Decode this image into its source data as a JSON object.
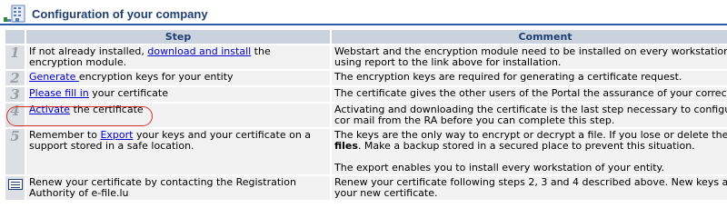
{
  "header": {
    "title": "Configuration of your company",
    "icon": "company-building-icon"
  },
  "table": {
    "columns": {
      "step": "Step",
      "comment": "Comment"
    },
    "rows": [
      {
        "num": "1",
        "step_pre": "If not already installed, ",
        "step_link": "download and install",
        "step_post": " the encryption module.",
        "comment": "Webstart and the encryption module need to be installed on every workstation using report to the link above for installation."
      },
      {
        "num": "2",
        "step_link": "Generate ",
        "step_post": "encryption keys for your entity",
        "comment": "The encryption keys are required for generating a certificate request."
      },
      {
        "num": "3",
        "step_link": "Please fill in",
        "step_post": " your certificate",
        "comment": "The certificate gives the other users of the Portal the assurance of your correct iden"
      },
      {
        "num": "4",
        "step_link": "Activate",
        "step_post": " the certificate",
        "comment": "Activating and downloading the certificate is the last step necessary to configure cor mail from the RA before you can complete this step."
      },
      {
        "num": "5",
        "step_pre": "Remember to ",
        "step_link": "Export",
        "step_post": " your keys and your certificate on a support stored in a safe location.",
        "comment_pre": "The keys are the only way to encrypt or decrypt a file. If you lose or delete the keys",
        "comment_bold": "files",
        "comment_mid": ". Make a backup stored in a secured place to prevent this situation.",
        "comment_post": "The export enables you to install every workstation of your entity."
      },
      {
        "icon": "certificate-renew-icon",
        "step": "Renew your certificate by contacting the Registration Authority of e-file.lu",
        "comment": "Renew your certificate following steps 2, 3 and 4 described above. New keys and ce your new certificate."
      }
    ]
  },
  "colors": {
    "header_bg": "#c9d2dd",
    "accent": "#1f3f73",
    "link": "#0000cc",
    "highlight": "#d9322b"
  }
}
